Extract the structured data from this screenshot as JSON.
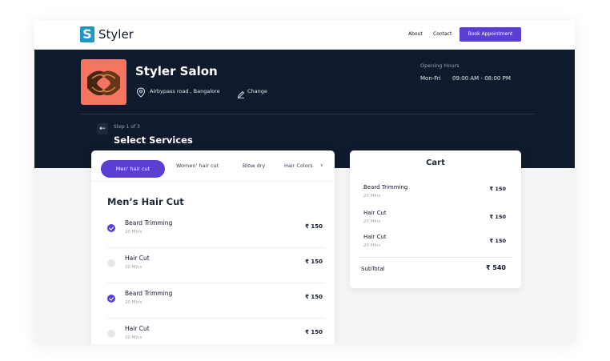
{
  "nav": {
    "logo_letter": "S",
    "logo_text": "Styler",
    "about": "About",
    "contact": "Contact",
    "cta": "Book Appointment"
  },
  "salon": {
    "name": "Styler Salon",
    "location": "Airbypass road , Bangalore",
    "change": "Change",
    "hours_label": "Opening Hours",
    "hours_days": "Mon-Fri",
    "hours_time": "09:00 AM - 08:00 PM"
  },
  "step": {
    "back_icon": "←",
    "label": "Step 1 of 3",
    "title": "Select Services"
  },
  "tabs": {
    "items": [
      "Men' hair cut",
      "Women' hair cut",
      "Blow dry",
      "Hair Colors"
    ],
    "active_index": 0,
    "more_icon": "›"
  },
  "services": {
    "section_title": "Men’s Hair Cut",
    "items": [
      {
        "name": "Beard Trimming",
        "duration": "20 Mins",
        "price": "₹ 150",
        "selected": true
      },
      {
        "name": "Hair Cut",
        "duration": "20 Mins",
        "price": "₹ 150",
        "selected": false
      },
      {
        "name": "Beard Trimming",
        "duration": "20 Mins",
        "price": "₹ 150",
        "selected": true
      },
      {
        "name": "Hair Cut",
        "duration": "20 Mins",
        "price": "₹ 150",
        "selected": false
      }
    ]
  },
  "cart": {
    "title": "Cart",
    "items": [
      {
        "name": "Beard Trimming",
        "duration": "20 Mins",
        "price": "₹ 150"
      },
      {
        "name": "Hair Cut",
        "duration": "20 Mins",
        "price": "₹ 150"
      },
      {
        "name": "Hair Cut",
        "duration": "20 Mins",
        "price": "₹ 150"
      }
    ],
    "subtotal_label": "SubTotal",
    "subtotal_value": "₹ 540"
  },
  "colors": {
    "accent": "#5b3fd3",
    "hero_bg": "#0f1b2d",
    "logo": "#1c97c6",
    "salon_tile": "#f47560"
  }
}
